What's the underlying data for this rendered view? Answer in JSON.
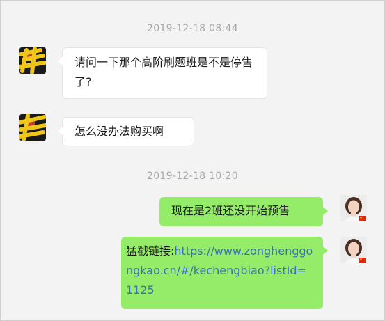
{
  "chat": {
    "timestamps": [
      "2019-12-18 08:44",
      "2019-12-18 10:20"
    ],
    "messages": [
      {
        "sender": "other",
        "text": "请问一下那个高阶刷题班是不是停售了?"
      },
      {
        "sender": "other",
        "text": "怎么没办法购买啊"
      },
      {
        "sender": "self",
        "text": "现在是2班还没开始预售"
      },
      {
        "sender": "self",
        "prefix": "猛戳链接:",
        "link": "https://www.zonghenggongkao.cn/#/kechengbiao?listId=1125"
      }
    ]
  },
  "colors": {
    "background": "#f3f3f3",
    "incoming_bubble": "#ffffff",
    "outgoing_bubble": "#95ec69",
    "link": "#3a6fc1",
    "timestamp": "#a8a8a8",
    "scribble": "#f0c61b"
  },
  "icons": {
    "other_avatar": "redacted-avatar-icon",
    "self_avatar": "user-portrait-avatar-icon",
    "flag": "flag-badge-icon"
  }
}
